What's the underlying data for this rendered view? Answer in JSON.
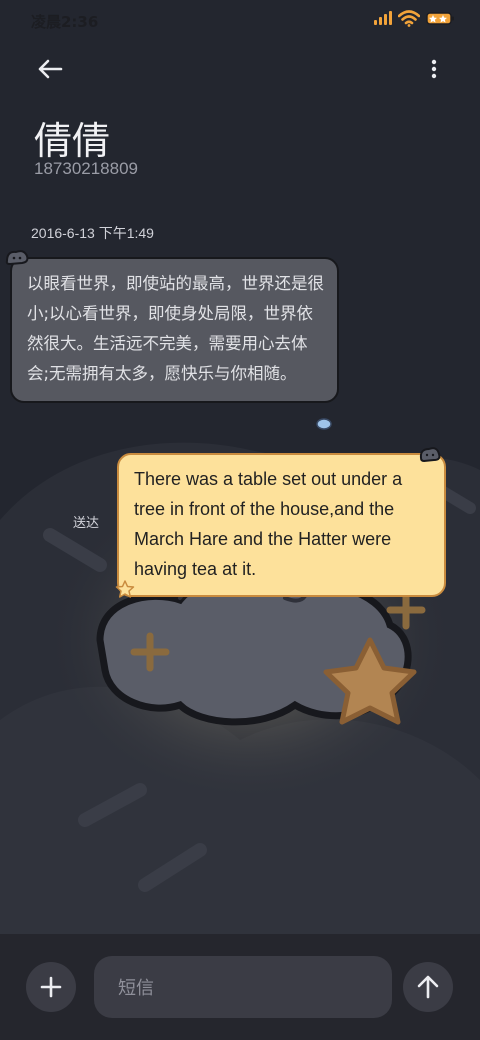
{
  "status_bar": {
    "time": "凌晨2:36",
    "icons": [
      "signal-icon",
      "wifi-icon",
      "battery-icon"
    ],
    "accent_color": "#f2a33a"
  },
  "header": {
    "back_icon": "back-arrow-icon",
    "menu_icon": "more-vertical-icon"
  },
  "contact": {
    "name": "倩倩",
    "number": "18730218809"
  },
  "conversation": {
    "timestamp": "2016-6-13 下午1:49",
    "incoming": {
      "text": "以眼看世界，即使站的最高，世界还是很小;以心看世界，即使身处局限，世界依然很大。生活远不完美，需要用心去体会;无需拥有太多，愿快乐与你相随。",
      "bubble_color": "#565860"
    },
    "outgoing": {
      "text": "There was a table set out under a tree in front of the house,and the March Hare and the Hatter were having tea at it.",
      "status": "送达",
      "bubble_color": "#fde19b"
    }
  },
  "composer": {
    "add_icon": "plus-icon",
    "placeholder": "短信",
    "send_icon": "send-arrow-icon"
  }
}
